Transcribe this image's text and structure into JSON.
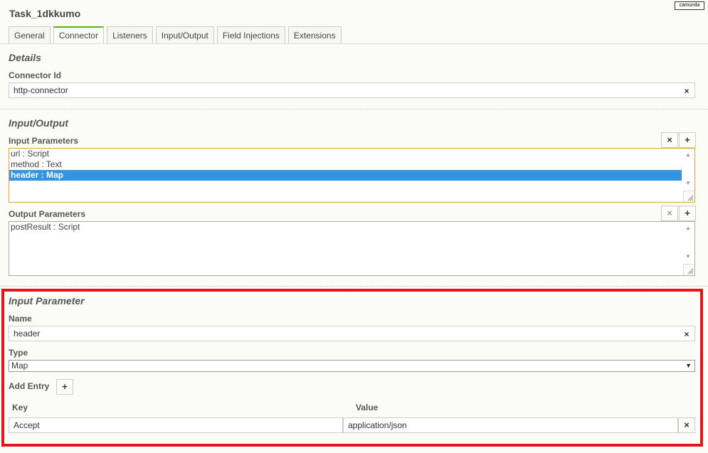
{
  "window": {
    "title": "Task_1dkkumo",
    "logo_text": "camunda"
  },
  "tabs": [
    {
      "label": "General"
    },
    {
      "label": "Connector"
    },
    {
      "label": "Listeners"
    },
    {
      "label": "Input/Output"
    },
    {
      "label": "Field Injections"
    },
    {
      "label": "Extensions"
    }
  ],
  "active_tab": "Connector",
  "details": {
    "section_title": "Details",
    "connector_id_label": "Connector Id",
    "connector_id_value": "http-connector",
    "clear_glyph": "×"
  },
  "io": {
    "section_title": "Input/Output",
    "input_label": "Input Parameters",
    "input_items": [
      "url : Script",
      "method : Text",
      "header : Map"
    ],
    "input_selected": "header : Map",
    "output_label": "Output Parameters",
    "output_items": [
      "postResult : Script"
    ],
    "remove_glyph": "×",
    "add_glyph": "+"
  },
  "input_parameter": {
    "section_title": "Input Parameter",
    "name_label": "Name",
    "name_value": "header",
    "type_label": "Type",
    "type_value": "Map",
    "add_entry_label": "Add Entry",
    "add_glyph": "+",
    "key_header": "Key",
    "value_header": "Value",
    "entries": [
      {
        "key": "Accept",
        "value": "application/json"
      }
    ],
    "remove_glyph": "×"
  },
  "colors": {
    "accent_tab": "#52b415",
    "selection": "#3395e2",
    "focus_border": "#e5a23e",
    "highlight_border": "#e1151b"
  }
}
